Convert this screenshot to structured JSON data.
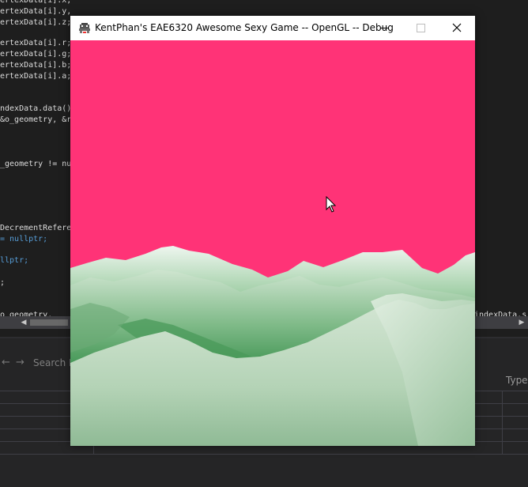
{
  "ide": {
    "code_left": [
      {
        "top": 0,
        "text": "ertexData[i].x,"
      },
      {
        "top": 0,
        "text": "ertexData[i].y,"
      },
      {
        "top": 0,
        "text": "ertexData[i].z;"
      },
      {
        "top": 0,
        "text": "ertexData[i].r;"
      },
      {
        "top": 0,
        "text": "ertexData[i].g;"
      },
      {
        "top": 0,
        "text": "ertexData[i].b;"
      },
      {
        "top": 0,
        "text": "ertexData[i].a;"
      },
      {
        "top": 0,
        "text": "ndexData.data()"
      },
      {
        "top": 0,
        "text": "&o_geometry, &r"
      },
      {
        "top": 0,
        "text": "_geometry != nu"
      },
      {
        "top": 0,
        "text": "DecrementRefere"
      },
      {
        "top": 0,
        "text": "= nullptr;"
      },
      {
        "top": 0,
        "text": "llptr;"
      },
      {
        "top": 0,
        "text": ";"
      },
      {
        "top": 0,
        "text": "o_geometry, "
      }
    ],
    "code_right": "indexData.s",
    "nav_back_glyph": "←",
    "nav_forward_glyph": "→",
    "search_placeholder": "Search D",
    "column_header": "Type"
  },
  "window": {
    "title": "KentPhan's EAE6320 Awesome Sexy Game -- OpenGL -- Debug",
    "sky_color": "#ff3377",
    "title_bar_color": "#ffffff"
  },
  "icons": {
    "app": "space-invader-icon",
    "minimize": "minimize-icon",
    "maximize": "maximize-icon",
    "close": "close-icon",
    "cursor": "mouse-cursor-icon"
  }
}
